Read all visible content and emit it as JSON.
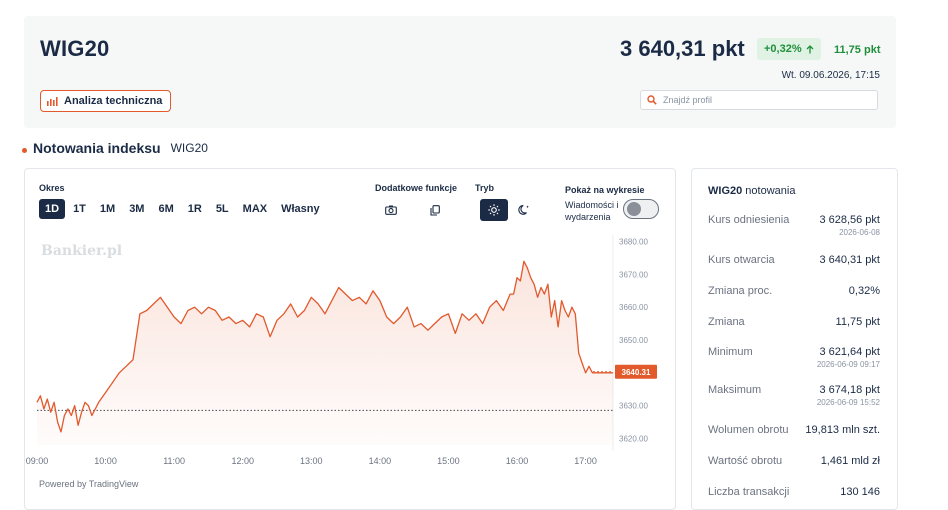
{
  "header": {
    "ticker": "WIG20",
    "analysis_button": "Analiza techniczna",
    "price": "3 640,31 pkt",
    "change_pct": "+0,32%",
    "change_abs": "11,75 pkt",
    "timestamp": "Wt. 09.06.2026, 17:15",
    "search_placeholder": "Znajdź profil"
  },
  "section": {
    "title": "Notowania indeksu",
    "subtitle": "WIG20"
  },
  "controls": {
    "period_label": "Okres",
    "periods": [
      "1D",
      "1T",
      "1M",
      "3M",
      "6M",
      "1R",
      "5L",
      "MAX",
      "Własny"
    ],
    "active_period": "1D",
    "extra_label": "Dodatkowe funkcje",
    "mode_label": "Tryb",
    "show_label": "Pokaż na wykresie",
    "toggle_label": "Wiadomości i wydarzenia",
    "toggle_on": false
  },
  "chart_data": {
    "type": "area",
    "watermark": "Bankier.pl",
    "x_ticks": [
      "09:00",
      "10:00",
      "11:00",
      "12:00",
      "13:00",
      "14:00",
      "15:00",
      "16:00",
      "17:00"
    ],
    "y_ticks": [
      3620,
      3630,
      3640,
      3650,
      3660,
      3670,
      3680
    ],
    "y_tick_labels": [
      "3620.00",
      "3630.00",
      "3640.00",
      "3650.00",
      "3660.00",
      "3670.00",
      "3680.00"
    ],
    "ylim": [
      3618,
      3682
    ],
    "xlim": [
      0,
      8.4
    ],
    "reference_level": 3628.56,
    "last_price": 3640.31,
    "last_price_label": "3640.31",
    "x": [
      0,
      0.05,
      0.1,
      0.15,
      0.2,
      0.25,
      0.3,
      0.35,
      0.4,
      0.45,
      0.5,
      0.55,
      0.6,
      0.65,
      0.7,
      0.75,
      0.8,
      0.9,
      1.0,
      1.1,
      1.2,
      1.3,
      1.4,
      1.5,
      1.6,
      1.7,
      1.8,
      1.9,
      2.0,
      2.1,
      2.2,
      2.3,
      2.4,
      2.5,
      2.6,
      2.7,
      2.8,
      2.9,
      3.0,
      3.1,
      3.2,
      3.3,
      3.4,
      3.5,
      3.6,
      3.7,
      3.8,
      3.9,
      4.0,
      4.1,
      4.2,
      4.3,
      4.4,
      4.5,
      4.6,
      4.7,
      4.8,
      4.9,
      5.0,
      5.1,
      5.2,
      5.3,
      5.4,
      5.5,
      5.6,
      5.7,
      5.8,
      5.9,
      6.0,
      6.1,
      6.2,
      6.3,
      6.4,
      6.5,
      6.6,
      6.7,
      6.8,
      6.9,
      6.95,
      7.0,
      7.05,
      7.1,
      7.15,
      7.2,
      7.25,
      7.3,
      7.35,
      7.4,
      7.45,
      7.5,
      7.55,
      7.6,
      7.65,
      7.7,
      7.75,
      7.8,
      7.85,
      7.9,
      7.95,
      8.0,
      8.05,
      8.1,
      8.2,
      8.3,
      8.4
    ],
    "y": [
      3631,
      3633,
      3629,
      3632,
      3628,
      3631,
      3625,
      3622,
      3627,
      3629,
      3627,
      3630,
      3624,
      3628,
      3631,
      3630,
      3627,
      3631,
      3634,
      3637,
      3640,
      3642,
      3644,
      3658,
      3659,
      3661,
      3663,
      3660,
      3657,
      3655,
      3659,
      3660,
      3658,
      3660,
      3659,
      3656,
      3657,
      3655,
      3656,
      3654,
      3658,
      3657,
      3651,
      3656,
      3658,
      3661,
      3657,
      3659,
      3663,
      3661,
      3658,
      3662,
      3666,
      3664,
      3662,
      3663,
      3661,
      3665,
      3662,
      3657,
      3655,
      3657,
      3660,
      3654,
      3655,
      3653,
      3655,
      3657,
      3658,
      3652,
      3658,
      3656,
      3658,
      3655,
      3660,
      3662,
      3659,
      3664,
      3664,
      3669,
      3668,
      3674,
      3672,
      3669,
      3667,
      3663,
      3666,
      3664,
      3667,
      3657,
      3662,
      3654,
      3662,
      3659,
      3657,
      3660,
      3658,
      3646,
      3643,
      3640,
      3642,
      3640,
      3640,
      3640,
      3640
    ],
    "title": "",
    "xlabel": "",
    "ylabel": "",
    "line_color": "#e2592c",
    "grid": false
  },
  "chart_footer": "Powered by TradingView",
  "stats": {
    "title_bold": "WIG20",
    "title_rest": "notowania",
    "rows": [
      {
        "label": "Kurs odniesienia",
        "value": "3 628,56 pkt",
        "date": "2026-06-08"
      },
      {
        "label": "Kurs otwarcia",
        "value": "3 640,31 pkt",
        "date": ""
      },
      {
        "label": "Zmiana proc.",
        "value": "0,32%",
        "date": ""
      },
      {
        "label": "Zmiana",
        "value": "11,75 pkt",
        "date": ""
      },
      {
        "label": "Minimum",
        "value": "3 621,64 pkt",
        "date": "2026-06-09 09:17"
      },
      {
        "label": "Maksimum",
        "value": "3 674,18 pkt",
        "date": "2026-06-09 15:52"
      },
      {
        "label": "Wolumen obrotu",
        "value": "19,813 mln szt.",
        "date": ""
      },
      {
        "label": "Wartość obrotu",
        "value": "1,461 mld zł",
        "date": ""
      },
      {
        "label": "Liczba transakcji",
        "value": "130 146",
        "date": ""
      }
    ]
  },
  "colors": {
    "accent": "#e2592c",
    "positive": "#1f8f3c",
    "positive_bg": "#dff2e3",
    "navy": "#1b2b45"
  }
}
